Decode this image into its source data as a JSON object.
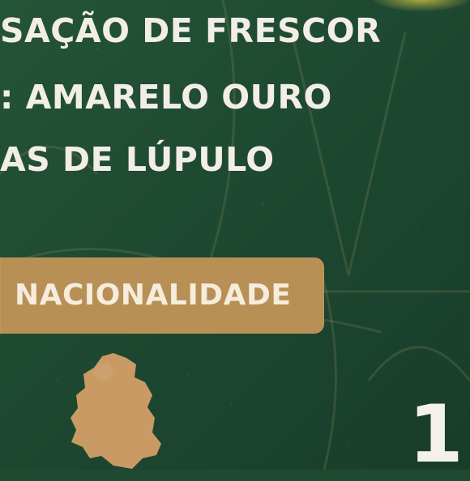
{
  "info": {
    "lines": [
      "SAÇÃO DE FRESCOR",
      ": AMARELO OURO",
      "AS DE LÚPULO"
    ]
  },
  "section": {
    "label": "NACIONALIDADE"
  },
  "badge": {
    "number": "1"
  },
  "colors": {
    "background": "#1f4a32",
    "accent": "#b88f55",
    "text": "#f2eee7"
  },
  "icons": {
    "country": "germany-map-icon"
  }
}
